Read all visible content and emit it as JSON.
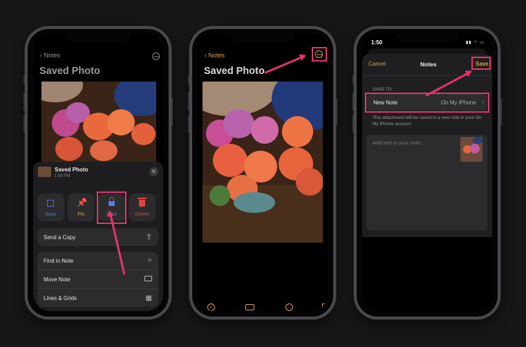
{
  "phone1": {
    "back_label": "Notes",
    "title": "Saved Photo",
    "share_header": {
      "title": "Saved Photo",
      "time": "1:50 PM"
    },
    "actions": [
      {
        "label": "Scan",
        "icon": "scan-icon",
        "color": "#5c7bd8"
      },
      {
        "label": "Pin",
        "icon": "pin-icon",
        "color": "#e3a53c"
      },
      {
        "label": "Lock",
        "icon": "lock-icon",
        "color": "#5c7bd8"
      },
      {
        "label": "Delete",
        "icon": "trash-icon",
        "color": "#e0453d"
      }
    ],
    "send_copy": "Send a Copy",
    "menu": [
      "Find in Note",
      "Move Note",
      "Lines & Grids"
    ]
  },
  "phone2": {
    "back_label": "Notes",
    "title": "Saved Photo",
    "toolbar": [
      "checklist-icon",
      "camera-icon",
      "markup-icon",
      "compose-icon"
    ]
  },
  "phone3": {
    "status_time": "1:50",
    "cancel": "Cancel",
    "nav_title": "Notes",
    "save": "Save",
    "save_to_label": "SAVE TO:",
    "destination_left": "New Note",
    "destination_right": "On My iPhone",
    "info_text": "This attachment will be saved in a new note in your On My iPhone account.",
    "placeholder": "Add text to your note..."
  },
  "colors": {
    "accent": "#e3a53c",
    "highlight": "#e8336d",
    "sheet": "#1e1e20",
    "cell": "#2c2c2e"
  }
}
